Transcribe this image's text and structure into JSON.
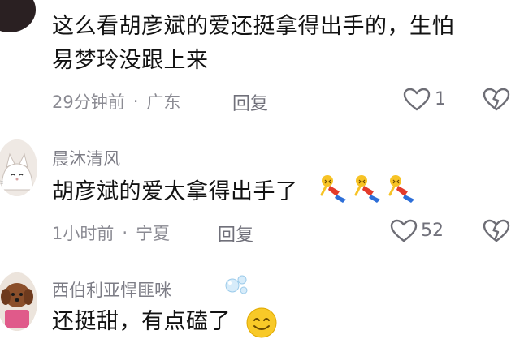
{
  "comments": [
    {
      "username": "",
      "text_line1": "这么看胡彦斌的爱还挺拿得出手的，生怕",
      "text_line2": "易梦玲没跟上来",
      "time": "29分钟前",
      "location": "广东",
      "reply_label": "回复",
      "like_count": "1",
      "like_icon": "heart-outline-icon",
      "dislike_icon": "broken-heart-outline-icon"
    },
    {
      "username": "晨沐清风",
      "text_line1": "胡彦斌的爱太拿得出手了",
      "time": "1小时前",
      "location": "宁夏",
      "reply_label": "回复",
      "like_count": "52",
      "like_icon": "heart-outline-icon",
      "dislike_icon": "broken-heart-outline-icon",
      "emoji": "kneeling-emoji"
    },
    {
      "username": "西伯利亚悍匪咪",
      "text_line1": "还挺甜，有点磕了",
      "emoji": "smile-emoji"
    }
  ],
  "colors": {
    "meta": "#8b8b93",
    "icon_stroke": "#6d6d75"
  }
}
